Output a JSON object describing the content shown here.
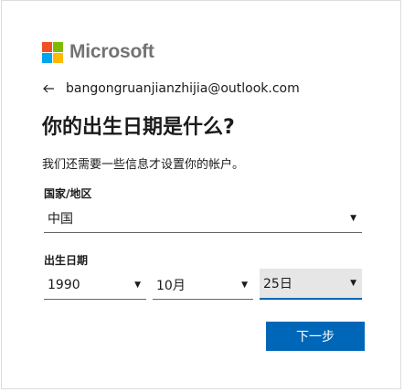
{
  "brand": {
    "name": "Microsoft",
    "colors": {
      "red": "#f25022",
      "green": "#7fba00",
      "blue": "#00a4ef",
      "yellow": "#ffb900"
    }
  },
  "identity": {
    "back_icon": "left-arrow-icon",
    "email": "bangongruanjianzhijia@outlook.com"
  },
  "heading": {
    "title": "你的出生日期是什么?",
    "subtitle": "我们还需要一些信息才设置你的帐户。"
  },
  "country": {
    "label": "国家/地区",
    "value": "中国",
    "caret_icon": "dropdown-caret-icon"
  },
  "birthdate": {
    "label": "出生日期",
    "year": "1990",
    "month": "10月",
    "day": "25日",
    "caret": "▼"
  },
  "actions": {
    "next_label": "下一步",
    "accent_color": "#0067b8"
  }
}
